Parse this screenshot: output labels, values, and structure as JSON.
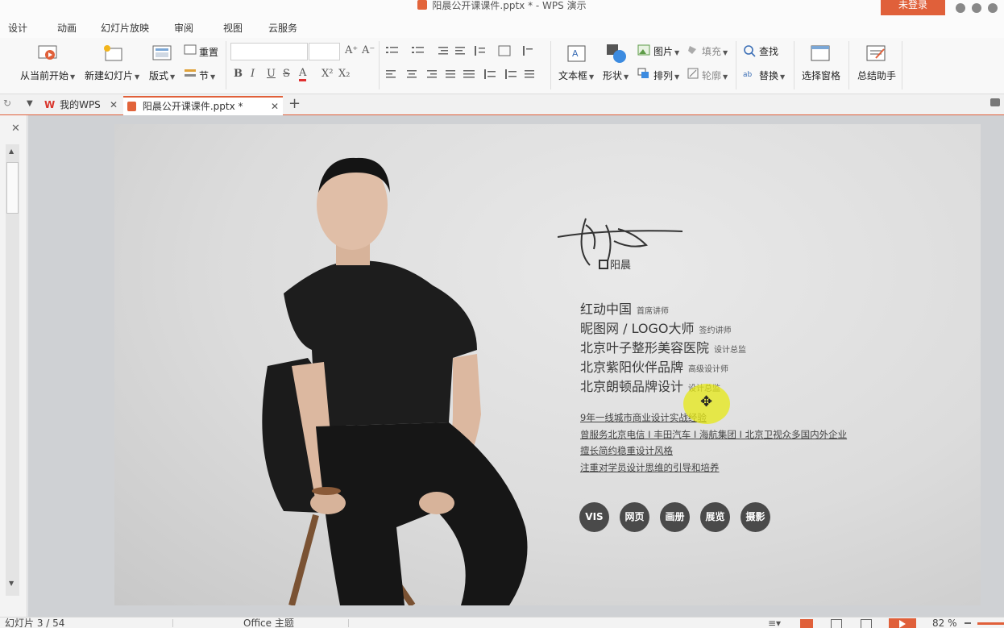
{
  "window": {
    "title": "阳晨公开课课件.pptx * - WPS 演示",
    "login_label": "未登录"
  },
  "menu": {
    "tabs": [
      "设计",
      "动画",
      "幻灯片放映",
      "审阅",
      "视图",
      "云服务"
    ]
  },
  "ribbon": {
    "play_from_current": "从当前开始",
    "new_slide": "新建幻灯片",
    "layout": "版式",
    "reset": "重置",
    "section": "节",
    "textbox": "文本框",
    "shape": "形状",
    "picture": "图片",
    "fill": "填充",
    "arrange": "排列",
    "outline": "轮廓",
    "find": "查找",
    "replace": "替换",
    "selection_pane": "选择窗格",
    "summary_assistant": "总结助手",
    "bold": "B",
    "italic": "I",
    "underline": "U",
    "strike": "S",
    "font_color": "A",
    "superscript": "X²",
    "subscript": "X₂",
    "grow": "A⁺",
    "shrink": "A⁻"
  },
  "doc_tabs": {
    "home": "我的WPS",
    "active": "阳晨公开课课件.pptx *"
  },
  "slide": {
    "signature_label": "阳晨",
    "roles": [
      {
        "name": "红动中国",
        "title": "首席讲师"
      },
      {
        "name": "昵图网 / LOGO大师",
        "title": "签约讲师"
      },
      {
        "name": "北京叶子整形美容医院",
        "title": "设计总监"
      },
      {
        "name": "北京紫阳伙伴品牌",
        "title": "高级设计师"
      },
      {
        "name": "北京朗顿品牌设计",
        "title": "设计总监"
      }
    ],
    "info": [
      "9年一线城市商业设计实战经验",
      "曾服务北京电信 I 丰田汽车 I 海航集团 I 北京卫视众多国内外企业",
      "擅长简约稳重设计风格",
      "注重对学员设计思维的引导和培养"
    ],
    "skills": [
      "VIS",
      "网页",
      "画册",
      "展览",
      "摄影"
    ]
  },
  "status": {
    "slide_index": "幻灯片 3 / 54",
    "theme": "Office 主题",
    "zoom": "82 %"
  },
  "colors": {
    "accent": "#e0603a"
  }
}
